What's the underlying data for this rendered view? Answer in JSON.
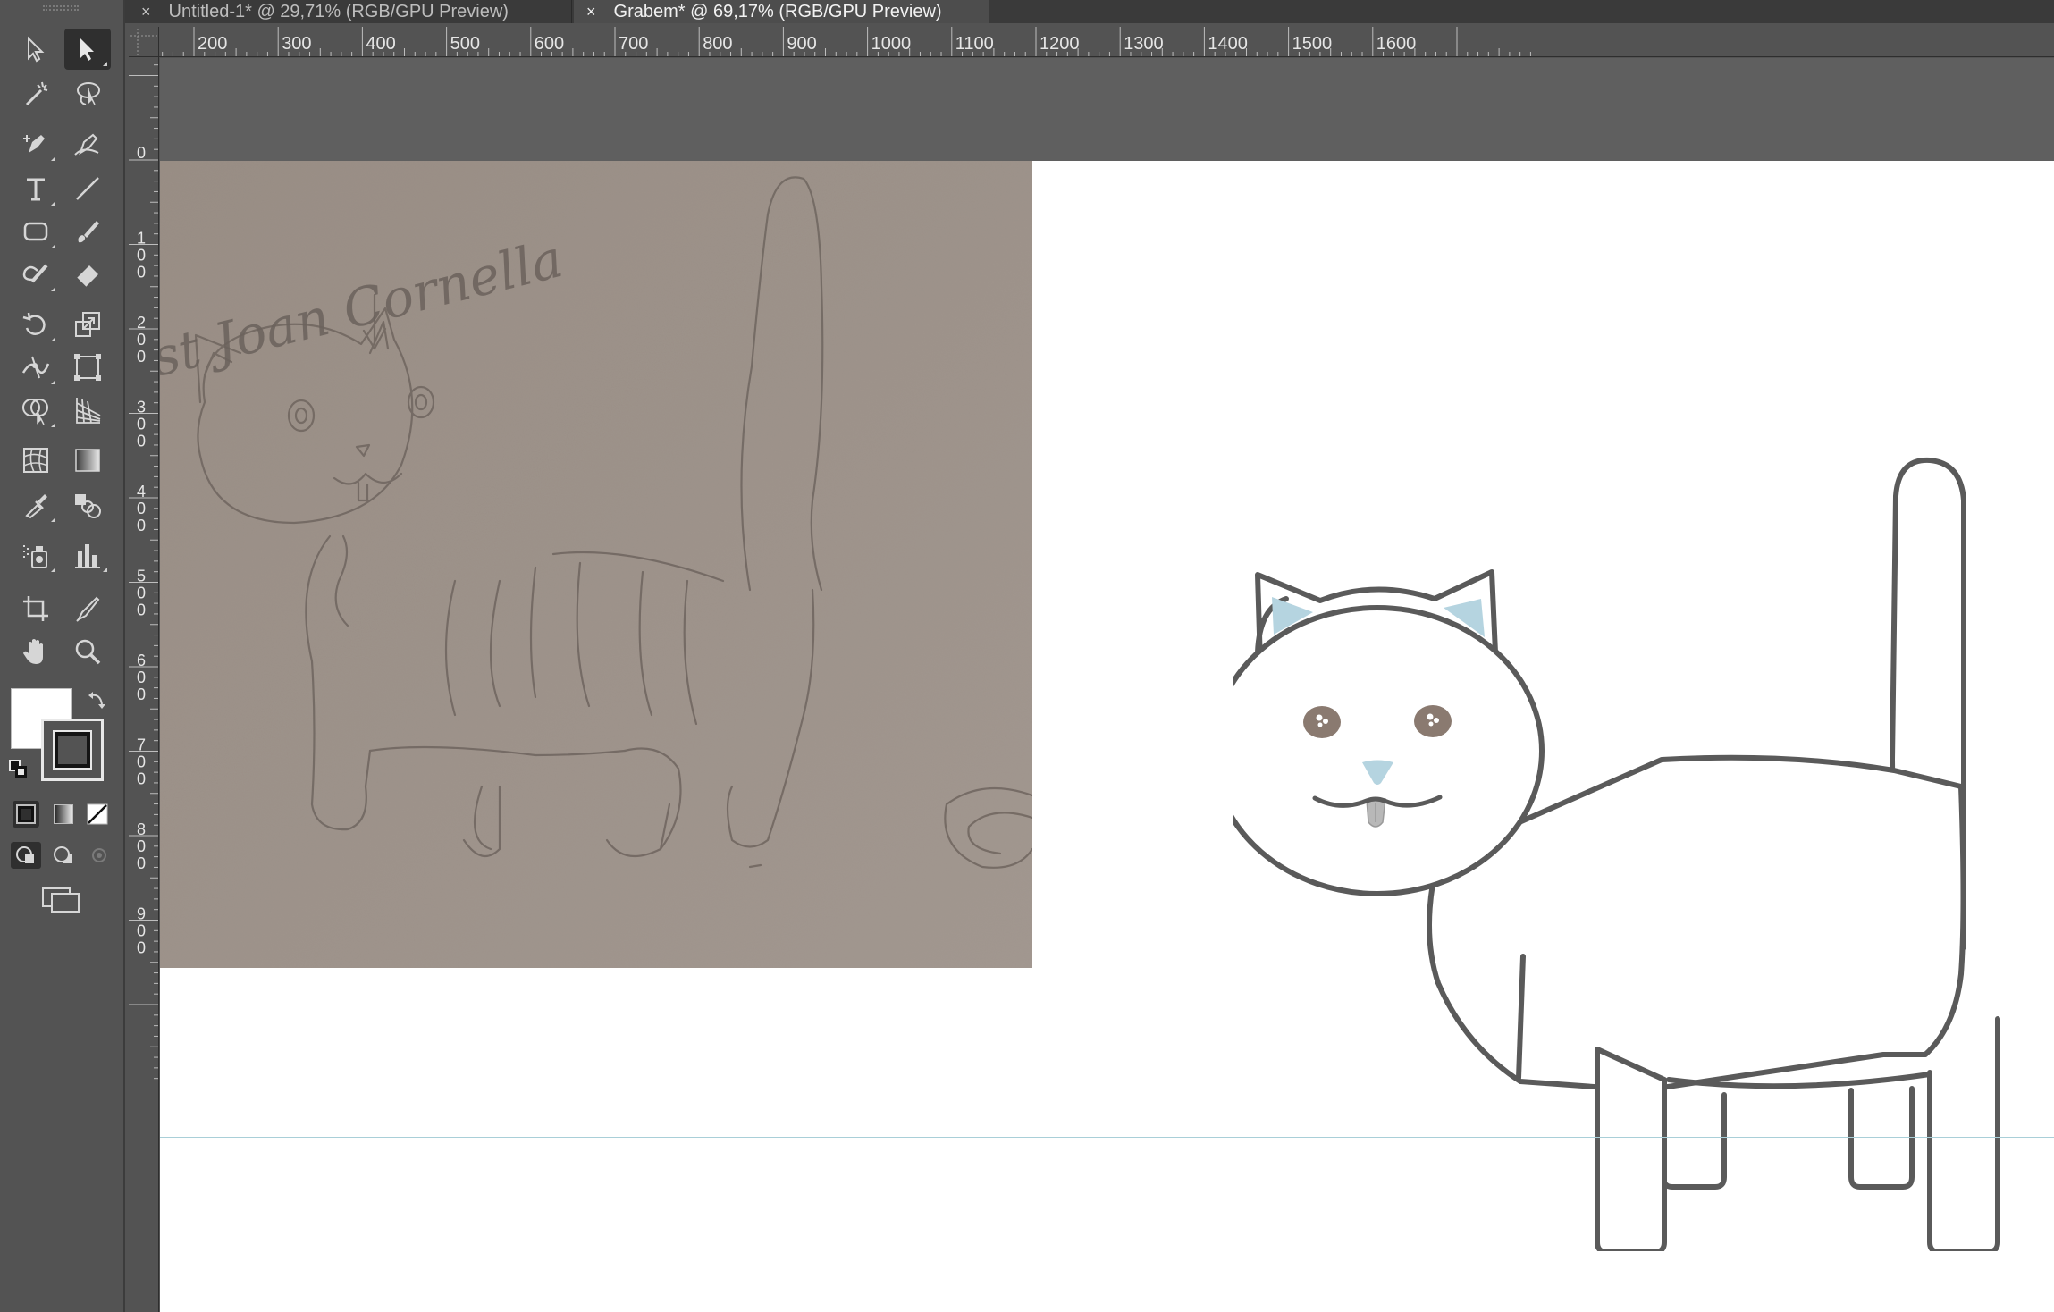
{
  "tabs": [
    {
      "close": "×",
      "label": "Untitled-1* @ 29,71% (RGB/GPU Preview)"
    },
    {
      "close": "×",
      "label": "Grabem* @ 69,17% (RGB/GPU Preview)"
    }
  ],
  "toolbar": {
    "tools": [
      {
        "name": "selection-tool-icon"
      },
      {
        "name": "direct-selection-tool-icon",
        "active": true
      },
      {
        "name": "magic-wand-tool-icon"
      },
      {
        "name": "lasso-tool-icon"
      },
      {
        "name": "pen-tool-icon"
      },
      {
        "name": "curvature-tool-icon"
      },
      {
        "name": "type-tool-icon"
      },
      {
        "name": "line-segment-tool-icon"
      },
      {
        "name": "rectangle-tool-icon"
      },
      {
        "name": "paintbrush-tool-icon"
      },
      {
        "name": "shaper-tool-icon"
      },
      {
        "name": "eraser-tool-icon"
      },
      {
        "name": "rotate-tool-icon"
      },
      {
        "name": "scale-tool-icon"
      },
      {
        "name": "width-tool-icon"
      },
      {
        "name": "free-transform-tool-icon"
      },
      {
        "name": "shape-builder-tool-icon"
      },
      {
        "name": "perspective-grid-tool-icon"
      },
      {
        "name": "mesh-tool-icon"
      },
      {
        "name": "gradient-tool-icon"
      },
      {
        "name": "eyedropper-tool-icon"
      },
      {
        "name": "blend-tool-icon"
      },
      {
        "name": "symbol-sprayer-tool-icon"
      },
      {
        "name": "column-graph-tool-icon"
      },
      {
        "name": "artboard-tool-icon"
      },
      {
        "name": "slice-tool-icon"
      },
      {
        "name": "hand-tool-icon"
      },
      {
        "name": "zoom-tool-icon"
      }
    ],
    "fill_color": "#ffffff",
    "stroke_color": "#1e1e1e"
  },
  "ruler": {
    "horizontal": [
      "200",
      "300",
      "400",
      "500",
      "600",
      "700",
      "800",
      "900",
      "1000",
      "1100",
      "1200",
      "1300",
      "1400",
      "1500",
      "1600"
    ],
    "vertical": [
      "0",
      "100",
      "200",
      "300",
      "400",
      "500",
      "600",
      "700",
      "800",
      "900"
    ]
  },
  "sketch": {
    "caption": "st Joan Cornella"
  },
  "colors": {
    "canvas": "#5f5f5f",
    "artboard": "#ffffff",
    "sketch_paper": "#9e938b",
    "cat_outline": "#5a5a5a",
    "ear_inner": "#b5d4e0",
    "eye": "#8a7a70",
    "nose": "#b5d4e0",
    "tongue": "#b8b8b8",
    "guide": "#a9cfd8"
  }
}
